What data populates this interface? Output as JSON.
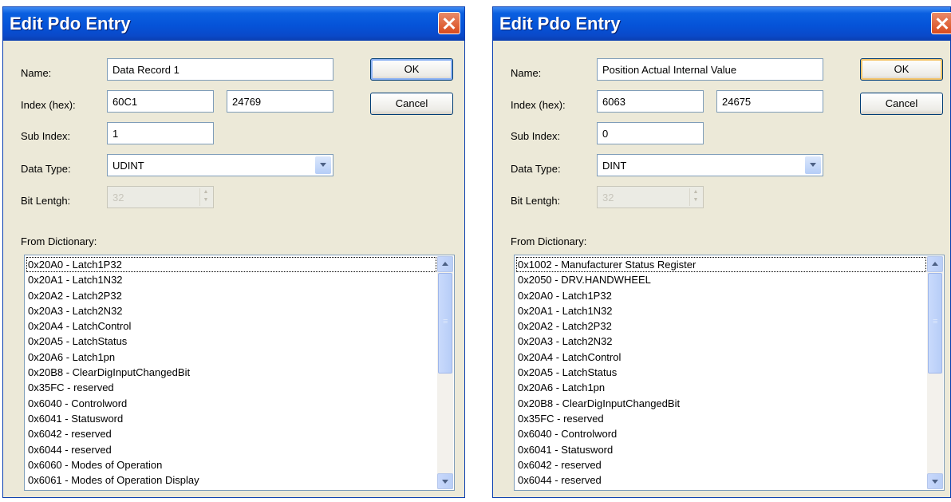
{
  "dialogs": [
    {
      "title": "Edit Pdo Entry",
      "labels": {
        "name": "Name:",
        "index": "Index (hex):",
        "subindex": "Sub Index:",
        "datatype": "Data Type:",
        "bitlength": "Bit Lentgh:",
        "dictionary": "From Dictionary:"
      },
      "name_value": "Data Record 1",
      "index_hex": "60C1",
      "index_dec": "24769",
      "subindex_value": "1",
      "datatype_value": "UDINT",
      "bitlength_value": "32",
      "ok_label": "OK",
      "cancel_label": "Cancel",
      "dictionary": [
        "0x20A0 - Latch1P32",
        "0x20A1 - Latch1N32",
        "0x20A2 - Latch2P32",
        "0x20A3 - Latch2N32",
        "0x20A4 - LatchControl",
        "0x20A5 - LatchStatus",
        "0x20A6 - Latch1pn",
        "0x20B8 - ClearDigInputChangedBit",
        "0x35FC - reserved",
        "0x6040 - Controlword",
        "0x6041 - Statusword",
        "0x6042 - reserved",
        "0x6044 - reserved",
        "0x6060 - Modes of Operation",
        "0x6061 - Modes of Operation Display"
      ]
    },
    {
      "title": "Edit Pdo Entry",
      "labels": {
        "name": "Name:",
        "index": "Index (hex):",
        "subindex": "Sub Index:",
        "datatype": "Data Type:",
        "bitlength": "Bit Lentgh:",
        "dictionary": "From Dictionary:"
      },
      "name_value": "Position Actual Internal Value",
      "index_hex": "6063",
      "index_dec": "24675",
      "subindex_value": "0",
      "datatype_value": "DINT",
      "bitlength_value": "32",
      "ok_label": "OK",
      "cancel_label": "Cancel",
      "dictionary": [
        "0x1002 - Manufacturer Status Register",
        "0x2050 - DRV.HANDWHEEL",
        "0x20A0 - Latch1P32",
        "0x20A1 - Latch1N32",
        "0x20A2 - Latch2P32",
        "0x20A3 - Latch2N32",
        "0x20A4 - LatchControl",
        "0x20A5 - LatchStatus",
        "0x20A6 - Latch1pn",
        "0x20B8 - ClearDigInputChangedBit",
        "0x35FC - reserved",
        "0x6040 - Controlword",
        "0x6041 - Statusword",
        "0x6042 - reserved",
        "0x6044 - reserved"
      ]
    }
  ],
  "icons": {
    "close": "close-x-icon",
    "combo_arrow": "chevron-down-icon",
    "scroll_up": "arrow-up-icon",
    "scroll_down": "arrow-down-icon"
  },
  "colors": {
    "titlebar": "#0553d8",
    "dialog_bg": "#ece9d8",
    "close_button": "#d94a1d",
    "field_border": "#7f9db9"
  }
}
